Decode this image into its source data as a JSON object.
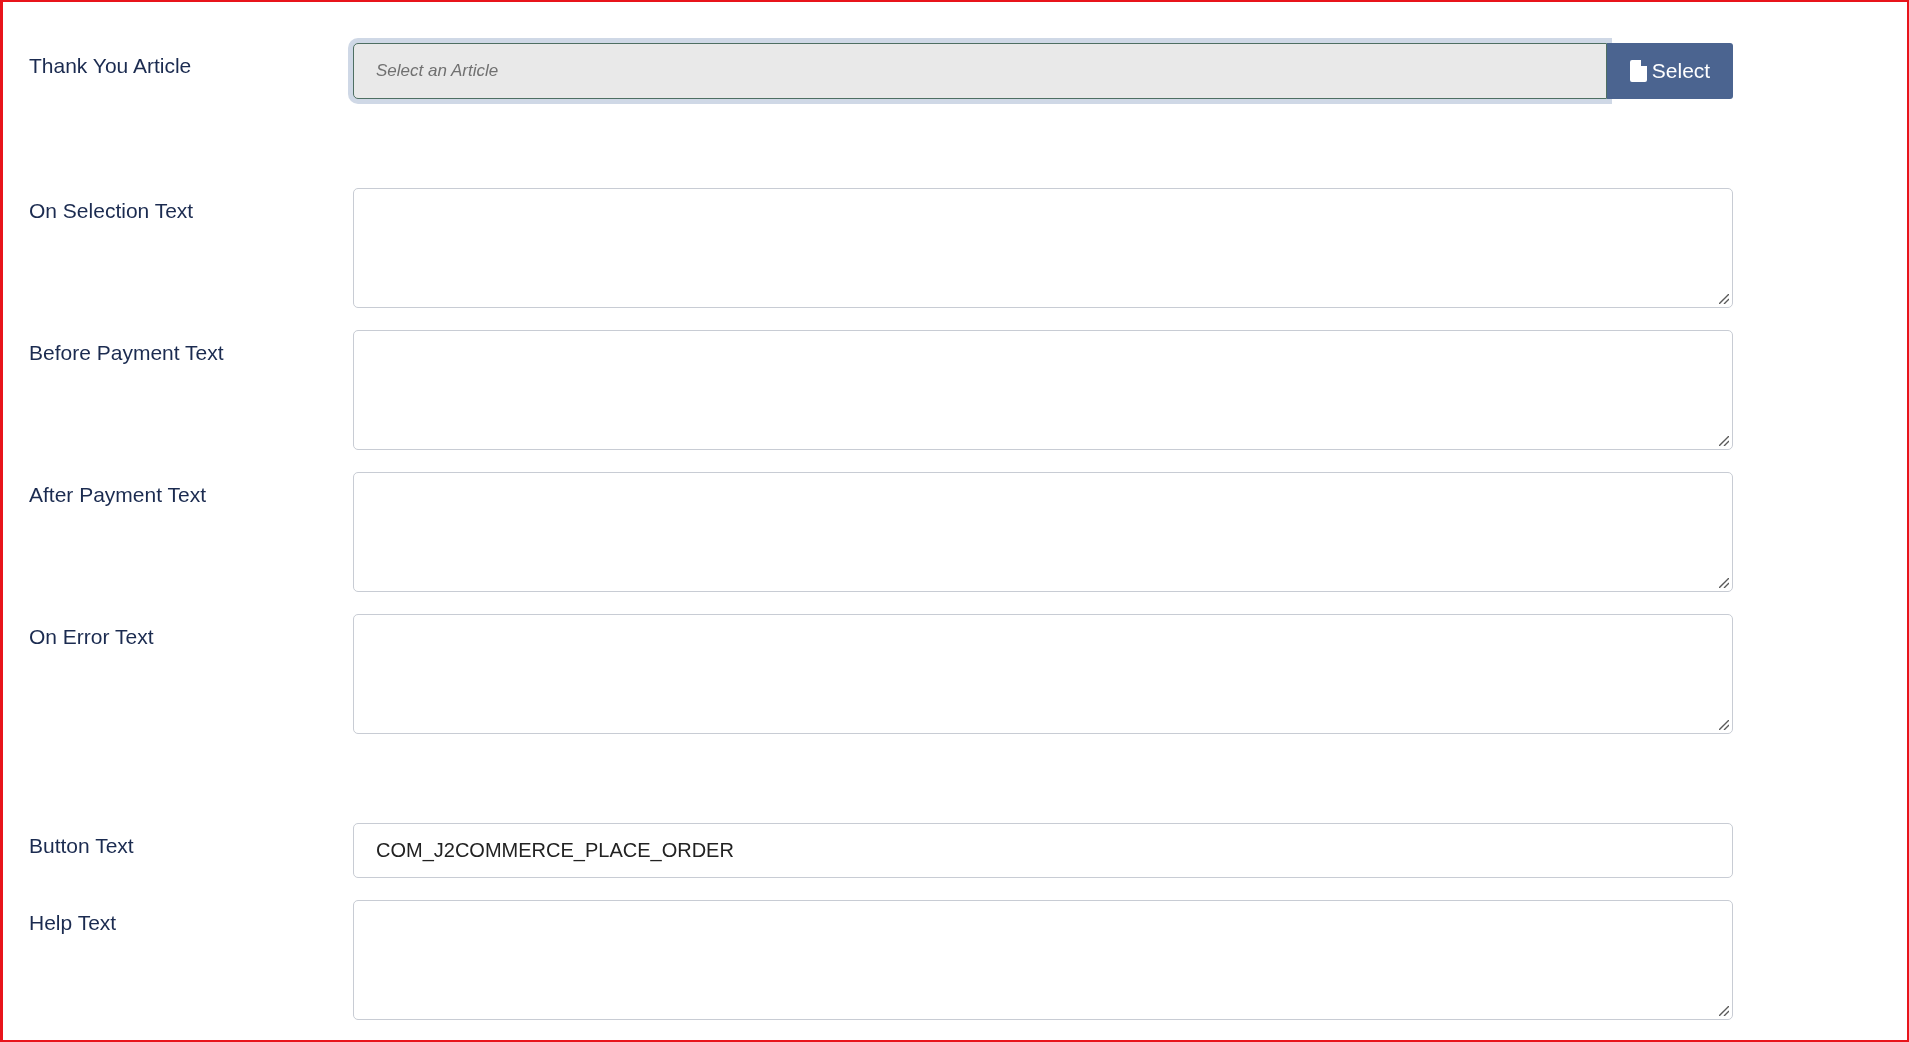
{
  "sections": [
    {
      "fields": [
        {
          "kind": "article_picker",
          "label": "Thank You Article",
          "placeholder": "Select an Article",
          "button": "Select",
          "focused": true
        }
      ]
    },
    {
      "fields": [
        {
          "kind": "textarea",
          "label": "On Selection Text"
        },
        {
          "kind": "textarea",
          "label": "Before Payment Text"
        },
        {
          "kind": "textarea",
          "label": "After Payment Text"
        },
        {
          "kind": "textarea",
          "label": "On Error Text"
        }
      ]
    },
    {
      "fields": [
        {
          "kind": "text",
          "label": "Button Text",
          "value": "COM_J2COMMERCE_PLACE_ORDER"
        },
        {
          "kind": "textarea",
          "label": "Help Text"
        }
      ]
    }
  ]
}
